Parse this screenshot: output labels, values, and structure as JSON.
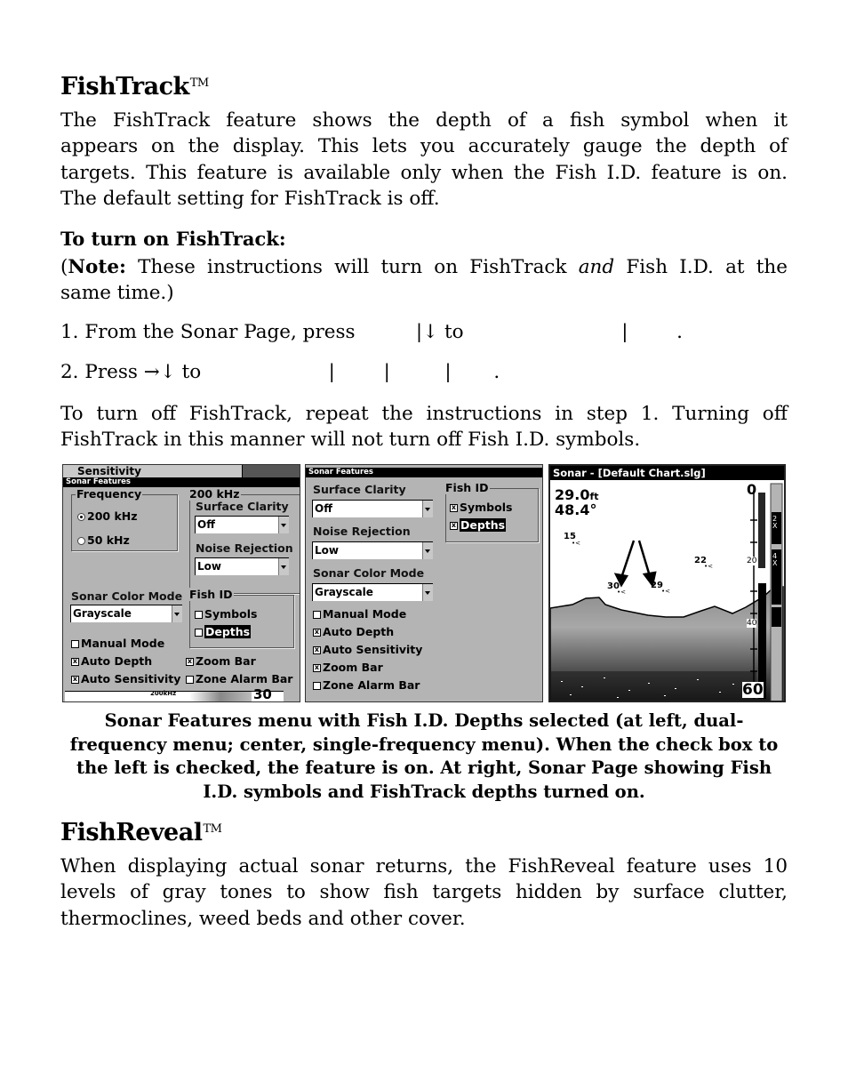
{
  "section1": {
    "title": "FishTrack",
    "tm": "TM",
    "paragraph_lines": [
      "The FishTrack feature shows the depth of a fish symbol when it",
      "appears on the display. This lets you accurately gauge the depth of",
      "targets. This feature is available only when the Fish I.D. feature is on.",
      "The default setting for FishTrack is off."
    ],
    "subheading": "To turn on FishTrack:",
    "note_label": "Note:",
    "note_line1_pre": "These instructions will turn on FishTrack ",
    "note_italic": "and",
    "note_line1_post": " Fish I.D. at the",
    "note_line2": "same time.)",
    "step1": "1. From the Sonar Page, press          |↓ to                          |        .",
    "step2": "2. Press →↓ to                     |        |         |       .",
    "off_lines": [
      "To turn off FishTrack, repeat the instructions in step 1. Turning off",
      "FishTrack in this manner will not turn off Fish I.D. symbols."
    ]
  },
  "screens": {
    "left": {
      "behind_label": "Sensitivity",
      "window_title": "Sonar Features",
      "frequency_group": "Frequency",
      "freq_options": [
        {
          "label": "200 kHz",
          "selected": true
        },
        {
          "label": "50 kHz",
          "selected": false
        }
      ],
      "khz_group": "200 kHz",
      "surface_clarity_label": "Surface Clarity",
      "surface_clarity_value": "Off",
      "noise_rejection_label": "Noise Rejection",
      "noise_rejection_value": "Low",
      "color_mode_label": "Sonar Color Mode",
      "color_mode_value": "Grayscale",
      "fish_id_group": "Fish ID",
      "fish_id_symbols": "Symbols",
      "fish_id_depths": "Depths",
      "checks": [
        {
          "label": "Manual Mode",
          "checked": false
        },
        {
          "label": "Auto Depth",
          "checked": true
        },
        {
          "label": "Auto Sensitivity",
          "checked": true
        },
        {
          "label": "Zoom Bar",
          "checked": true
        },
        {
          "label": "Zone Alarm Bar",
          "checked": false
        }
      ],
      "behind_bottom_label": "200kHz",
      "behind_bottom_number": "30"
    },
    "center": {
      "window_title": "Sonar Features",
      "surface_clarity_label": "Surface Clarity",
      "surface_clarity_value": "Off",
      "noise_rejection_label": "Noise Rejection",
      "noise_rejection_value": "Low",
      "color_mode_label": "Sonar Color Mode",
      "color_mode_value": "Grayscale",
      "fish_id_group": "Fish ID",
      "fish_id_symbols": "Symbols",
      "fish_id_depths": "Depths",
      "checks": [
        {
          "label": "Manual Mode",
          "checked": false
        },
        {
          "label": "Auto Depth",
          "checked": true
        },
        {
          "label": "Auto Sensitivity",
          "checked": true
        },
        {
          "label": "Zoom Bar",
          "checked": true
        },
        {
          "label": "Zone Alarm Bar",
          "checked": false
        }
      ]
    },
    "right": {
      "window_title": "Sonar - [Default Chart.slg]",
      "depth": "29.0",
      "depth_unit": "ft",
      "temperature": "48.4°",
      "fish_depths": [
        "15",
        "30",
        "29",
        "22"
      ],
      "scale_labels": [
        "0",
        "20",
        "40",
        "60"
      ],
      "zoom_labels": [
        "2X",
        "4X"
      ]
    }
  },
  "caption_lines": [
    "Sonar Features menu with Fish I.D. Depths selected (at left, dual-",
    "frequency menu; center, single-frequency menu). When the check box to",
    "the left is checked, the feature is on. At right, Sonar Page showing Fish",
    "I.D. symbols and FishTrack depths turned on."
  ],
  "section2": {
    "title": "FishReveal",
    "tm": "TM",
    "paragraph_lines": [
      "When displaying actual sonar returns, the FishReveal feature uses 10",
      "levels of gray tones to show fish targets hidden by surface clutter,",
      "thermoclines, weed beds and other cover."
    ]
  }
}
